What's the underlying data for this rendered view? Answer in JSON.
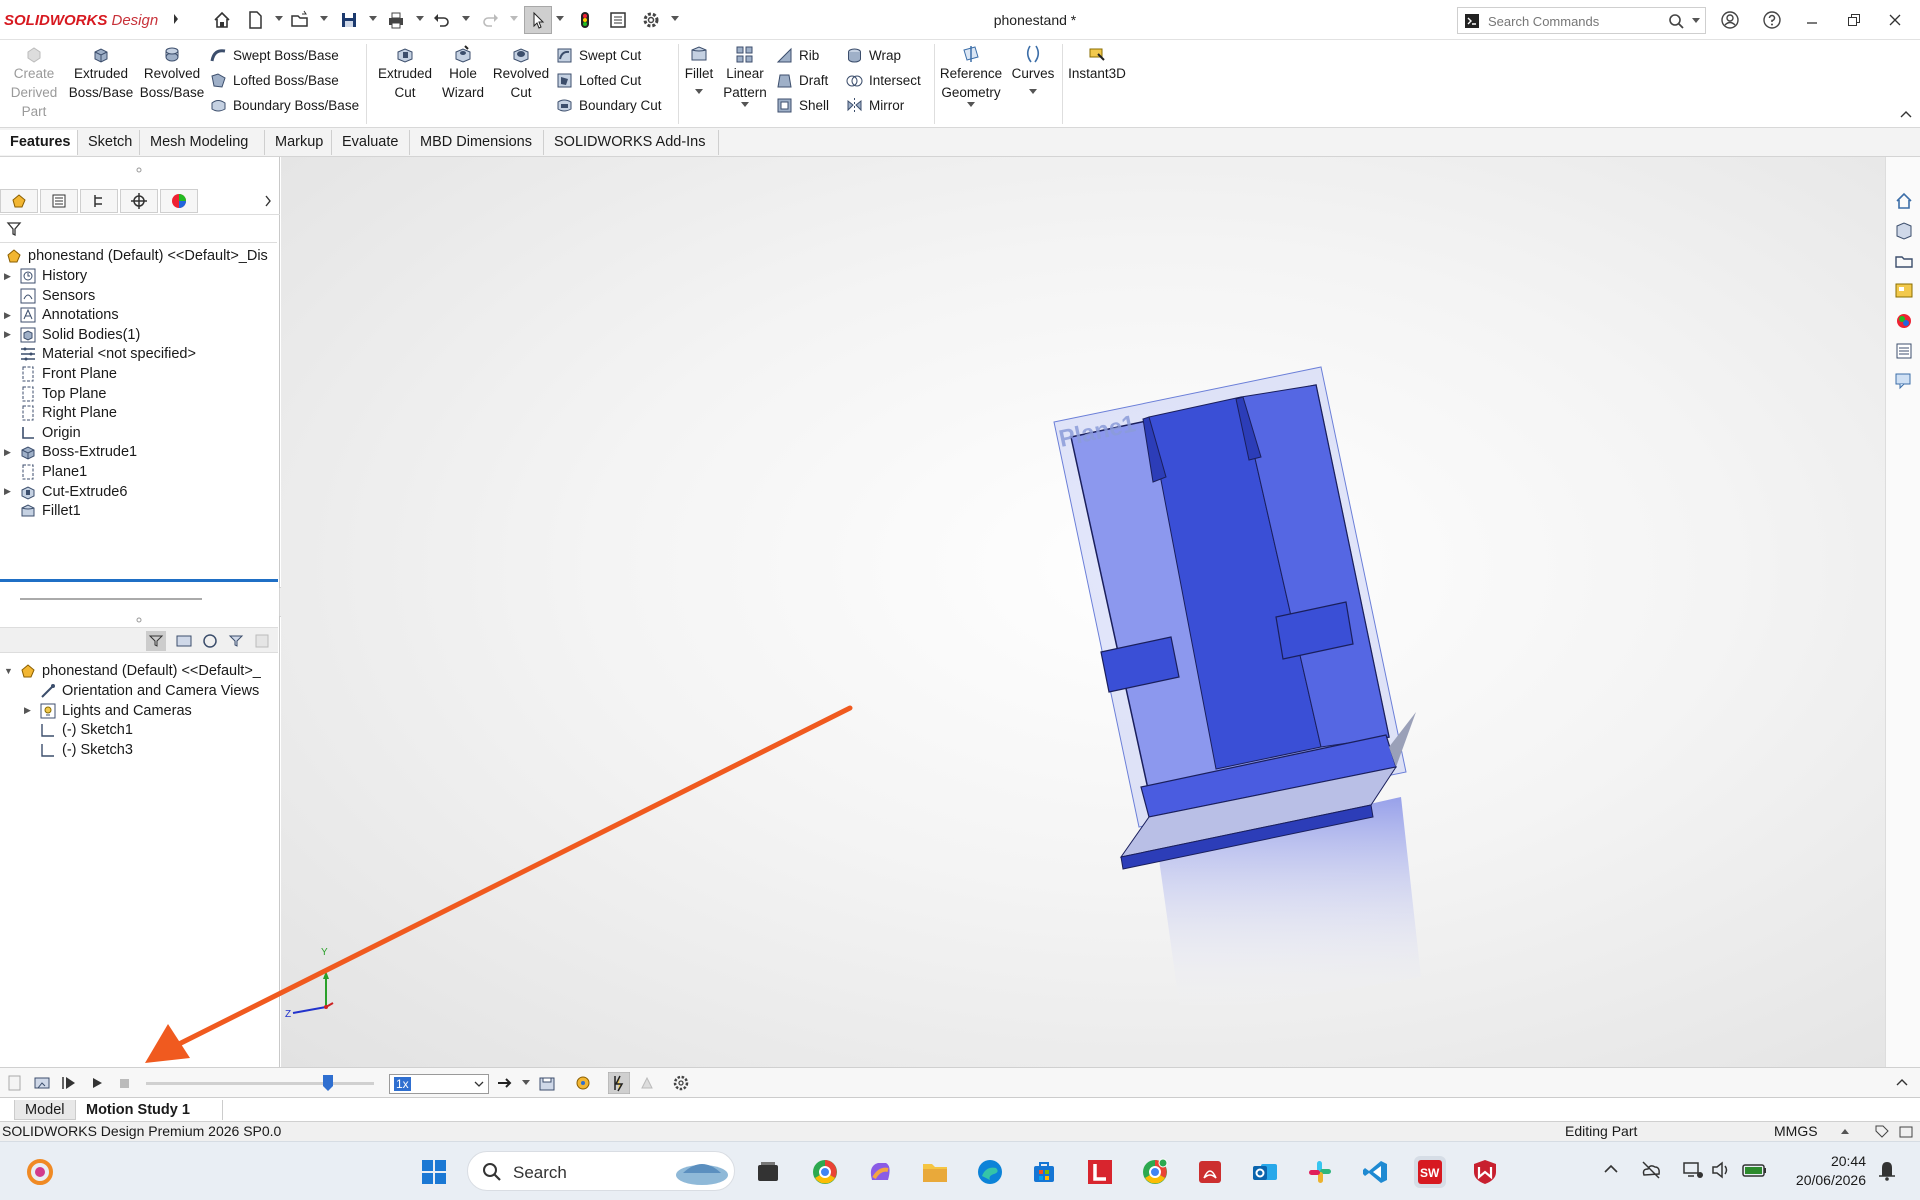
{
  "app": {
    "brand_bold": "SOLIDWORKS",
    "brand_rest": " Design",
    "doc_title": "phonestand *",
    "search_placeholder": "Search Commands",
    "accent": "#d71920"
  },
  "quick_access": [
    "home-icon",
    "new-document-icon",
    "open-icon",
    "save-icon",
    "print-icon",
    "undo-icon",
    "redo-icon",
    "select-icon",
    "rebuild-icon",
    "file-properties-icon",
    "options-icon"
  ],
  "ribbon": {
    "create_derived": [
      "Create",
      "Derived",
      "Part"
    ],
    "extruded_boss": [
      "Extruded",
      "Boss/Base"
    ],
    "revolved_boss": [
      "Revolved",
      "Boss/Base"
    ],
    "swept_boss": "Swept Boss/Base",
    "lofted_boss": "Lofted Boss/Base",
    "boundary_boss": "Boundary Boss/Base",
    "extruded_cut": [
      "Extruded",
      "Cut"
    ],
    "hole_wizard": [
      "Hole",
      "Wizard"
    ],
    "revolved_cut": [
      "Revolved",
      "Cut"
    ],
    "swept_cut": "Swept Cut",
    "lofted_cut": "Lofted Cut",
    "boundary_cut": "Boundary Cut",
    "fillet": "Fillet",
    "linear_pattern": [
      "Linear",
      "Pattern"
    ],
    "rib": "Rib",
    "draft": "Draft",
    "shell": "Shell",
    "wrap": "Wrap",
    "intersect": "Intersect",
    "mirror": "Mirror",
    "reference_geometry": [
      "Reference",
      "Geometry"
    ],
    "curves": "Curves",
    "instant3d": "Instant3D"
  },
  "command_tabs": [
    "Features",
    "Sketch",
    "Mesh Modeling",
    "Markup",
    "Evaluate",
    "MBD Dimensions",
    "SOLIDWORKS Add-Ins"
  ],
  "feature_tree": {
    "root": "phonestand (Default) <<Default>_Dis",
    "items": [
      {
        "label": "History",
        "icon": "history-icon",
        "expandable": true
      },
      {
        "label": "Sensors",
        "icon": "sensors-icon",
        "expandable": false
      },
      {
        "label": "Annotations",
        "icon": "annotations-icon",
        "expandable": true
      },
      {
        "label": "Solid Bodies(1)",
        "icon": "solid-bodies-icon",
        "expandable": true
      },
      {
        "label": "Material <not specified>",
        "icon": "material-icon",
        "expandable": false
      },
      {
        "label": "Front Plane",
        "icon": "plane-icon",
        "expandable": false
      },
      {
        "label": "Top Plane",
        "icon": "plane-icon",
        "expandable": false
      },
      {
        "label": "Right Plane",
        "icon": "plane-icon",
        "expandable": false
      },
      {
        "label": "Origin",
        "icon": "origin-icon",
        "expandable": false
      },
      {
        "label": "Boss-Extrude1",
        "icon": "boss-extrude-icon",
        "expandable": true
      },
      {
        "label": "Plane1",
        "icon": "plane-icon",
        "expandable": false
      },
      {
        "label": "Cut-Extrude6",
        "icon": "cut-extrude-icon",
        "expandable": true
      },
      {
        "label": "Fillet1",
        "icon": "fillet-icon",
        "expandable": false
      }
    ]
  },
  "motion_tree": {
    "root": "phonestand (Default) <<Default>_",
    "items": [
      {
        "label": "Orientation and Camera Views",
        "icon": "camera-views-icon",
        "expandable": false
      },
      {
        "label": "Lights and Cameras",
        "icon": "lights-icon",
        "expandable": true
      },
      {
        "label": "(-) Sketch1",
        "icon": "sketch-icon",
        "expandable": false
      },
      {
        "label": "(-) Sketch3",
        "icon": "sketch-icon",
        "expandable": false
      }
    ]
  },
  "viewport": {
    "plane_label": "Plane1",
    "triad_y": "Y",
    "triad_z": "Z",
    "part_color": "#3a4fd6",
    "annotation_arrow_color": "#f05a1f"
  },
  "motion": {
    "speed": "1x",
    "slider_position_pct": 80
  },
  "bottom_tabs": [
    "Model",
    "Motion Study 1"
  ],
  "status": {
    "left": "SOLIDWORKS Design Premium 2026 SP0.0",
    "mode": "Editing Part",
    "units": "MMGS"
  },
  "taskbar": {
    "search_label": "Search",
    "time": "20:44",
    "date": "20/06/2026"
  }
}
